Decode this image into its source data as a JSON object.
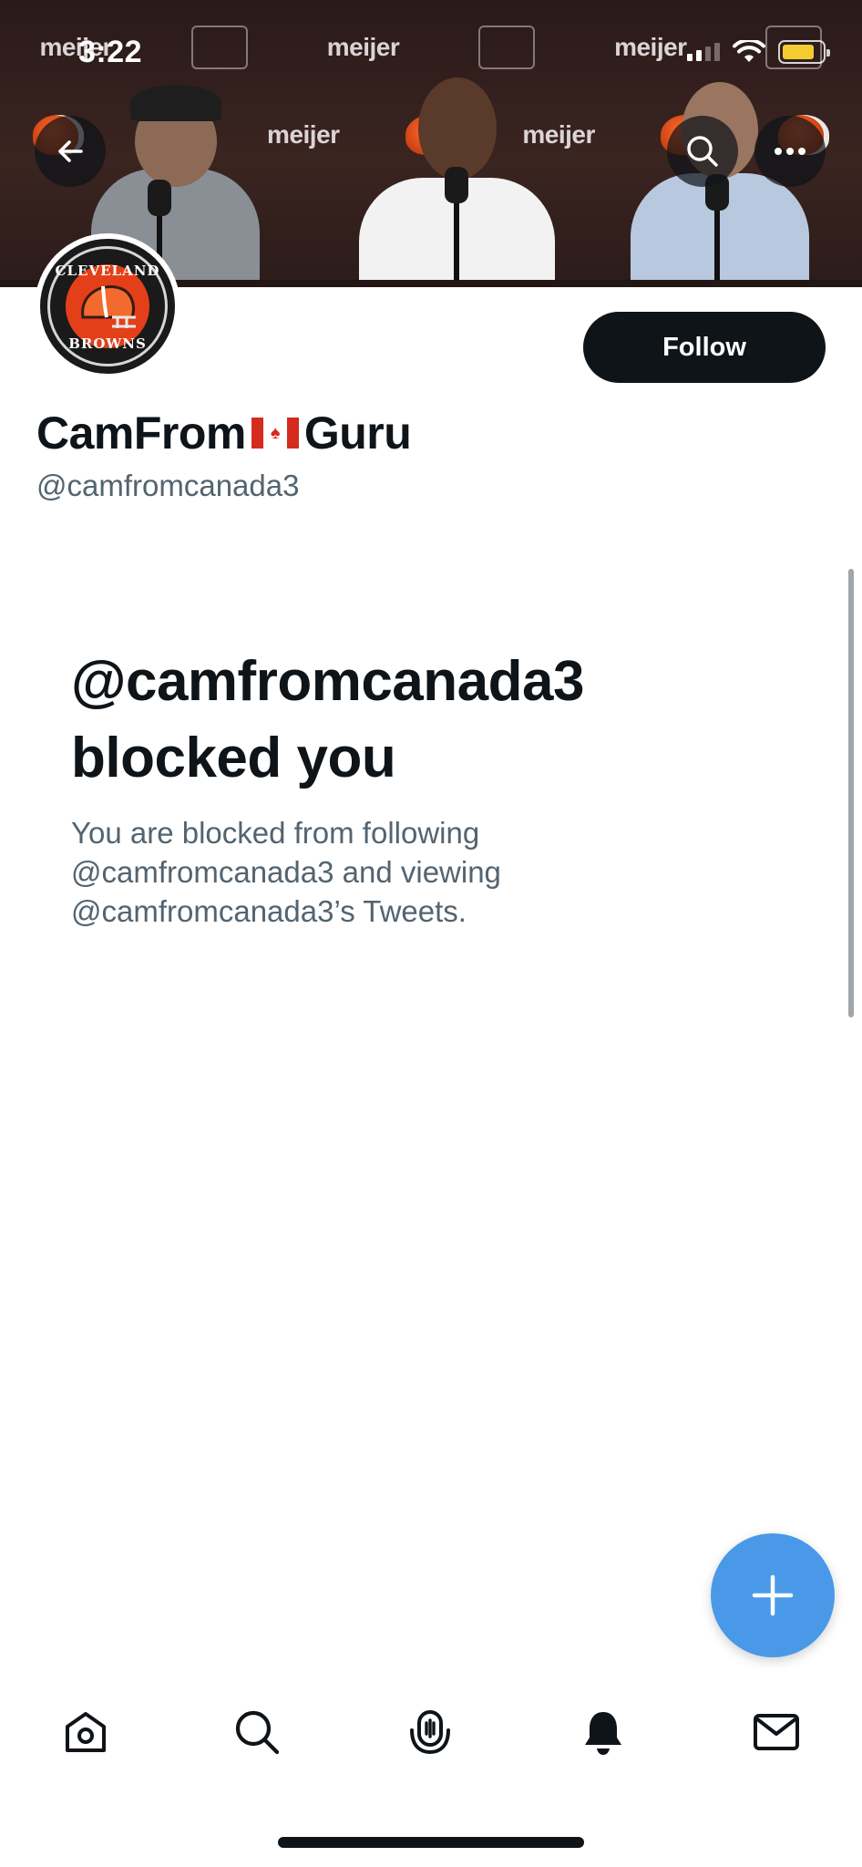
{
  "status_bar": {
    "time": "3:22",
    "signal_bars_active": 2,
    "signal_bars_total": 4,
    "battery_level": 0.8,
    "battery_color": "#f4cc32"
  },
  "banner": {
    "backdrop_words": [
      "meijer",
      "meijer",
      "meijer",
      "meijer",
      "meijer"
    ],
    "buttons": {
      "back": "arrow-left-icon",
      "search": "search-icon",
      "more": "more-horizontal-icon"
    }
  },
  "profile": {
    "avatar_text_top": "CLEVELAND",
    "avatar_text_bottom": "BROWNS",
    "follow_label": "Follow",
    "name_before_flag": "CamFrom",
    "name_after_flag": "Guru",
    "handle": "@camfromcanada3"
  },
  "blocked": {
    "title": "@camfromcanada3 blocked you",
    "description": "You are blocked from following @camfromcanada3 and viewing @camfromcanada3’s Tweets."
  },
  "fab": {
    "icon": "plus-icon"
  },
  "tabbar": {
    "tabs": [
      {
        "icon": "home-icon",
        "selected": false
      },
      {
        "icon": "search-icon",
        "selected": false
      },
      {
        "icon": "spaces-icon",
        "selected": false
      },
      {
        "icon": "bell-icon",
        "selected": true
      },
      {
        "icon": "mail-icon",
        "selected": false
      }
    ]
  },
  "colors": {
    "accent": "#4a99e9",
    "text_primary": "#0f1419",
    "text_secondary": "#536471",
    "brand_orange": "#e3401a"
  }
}
